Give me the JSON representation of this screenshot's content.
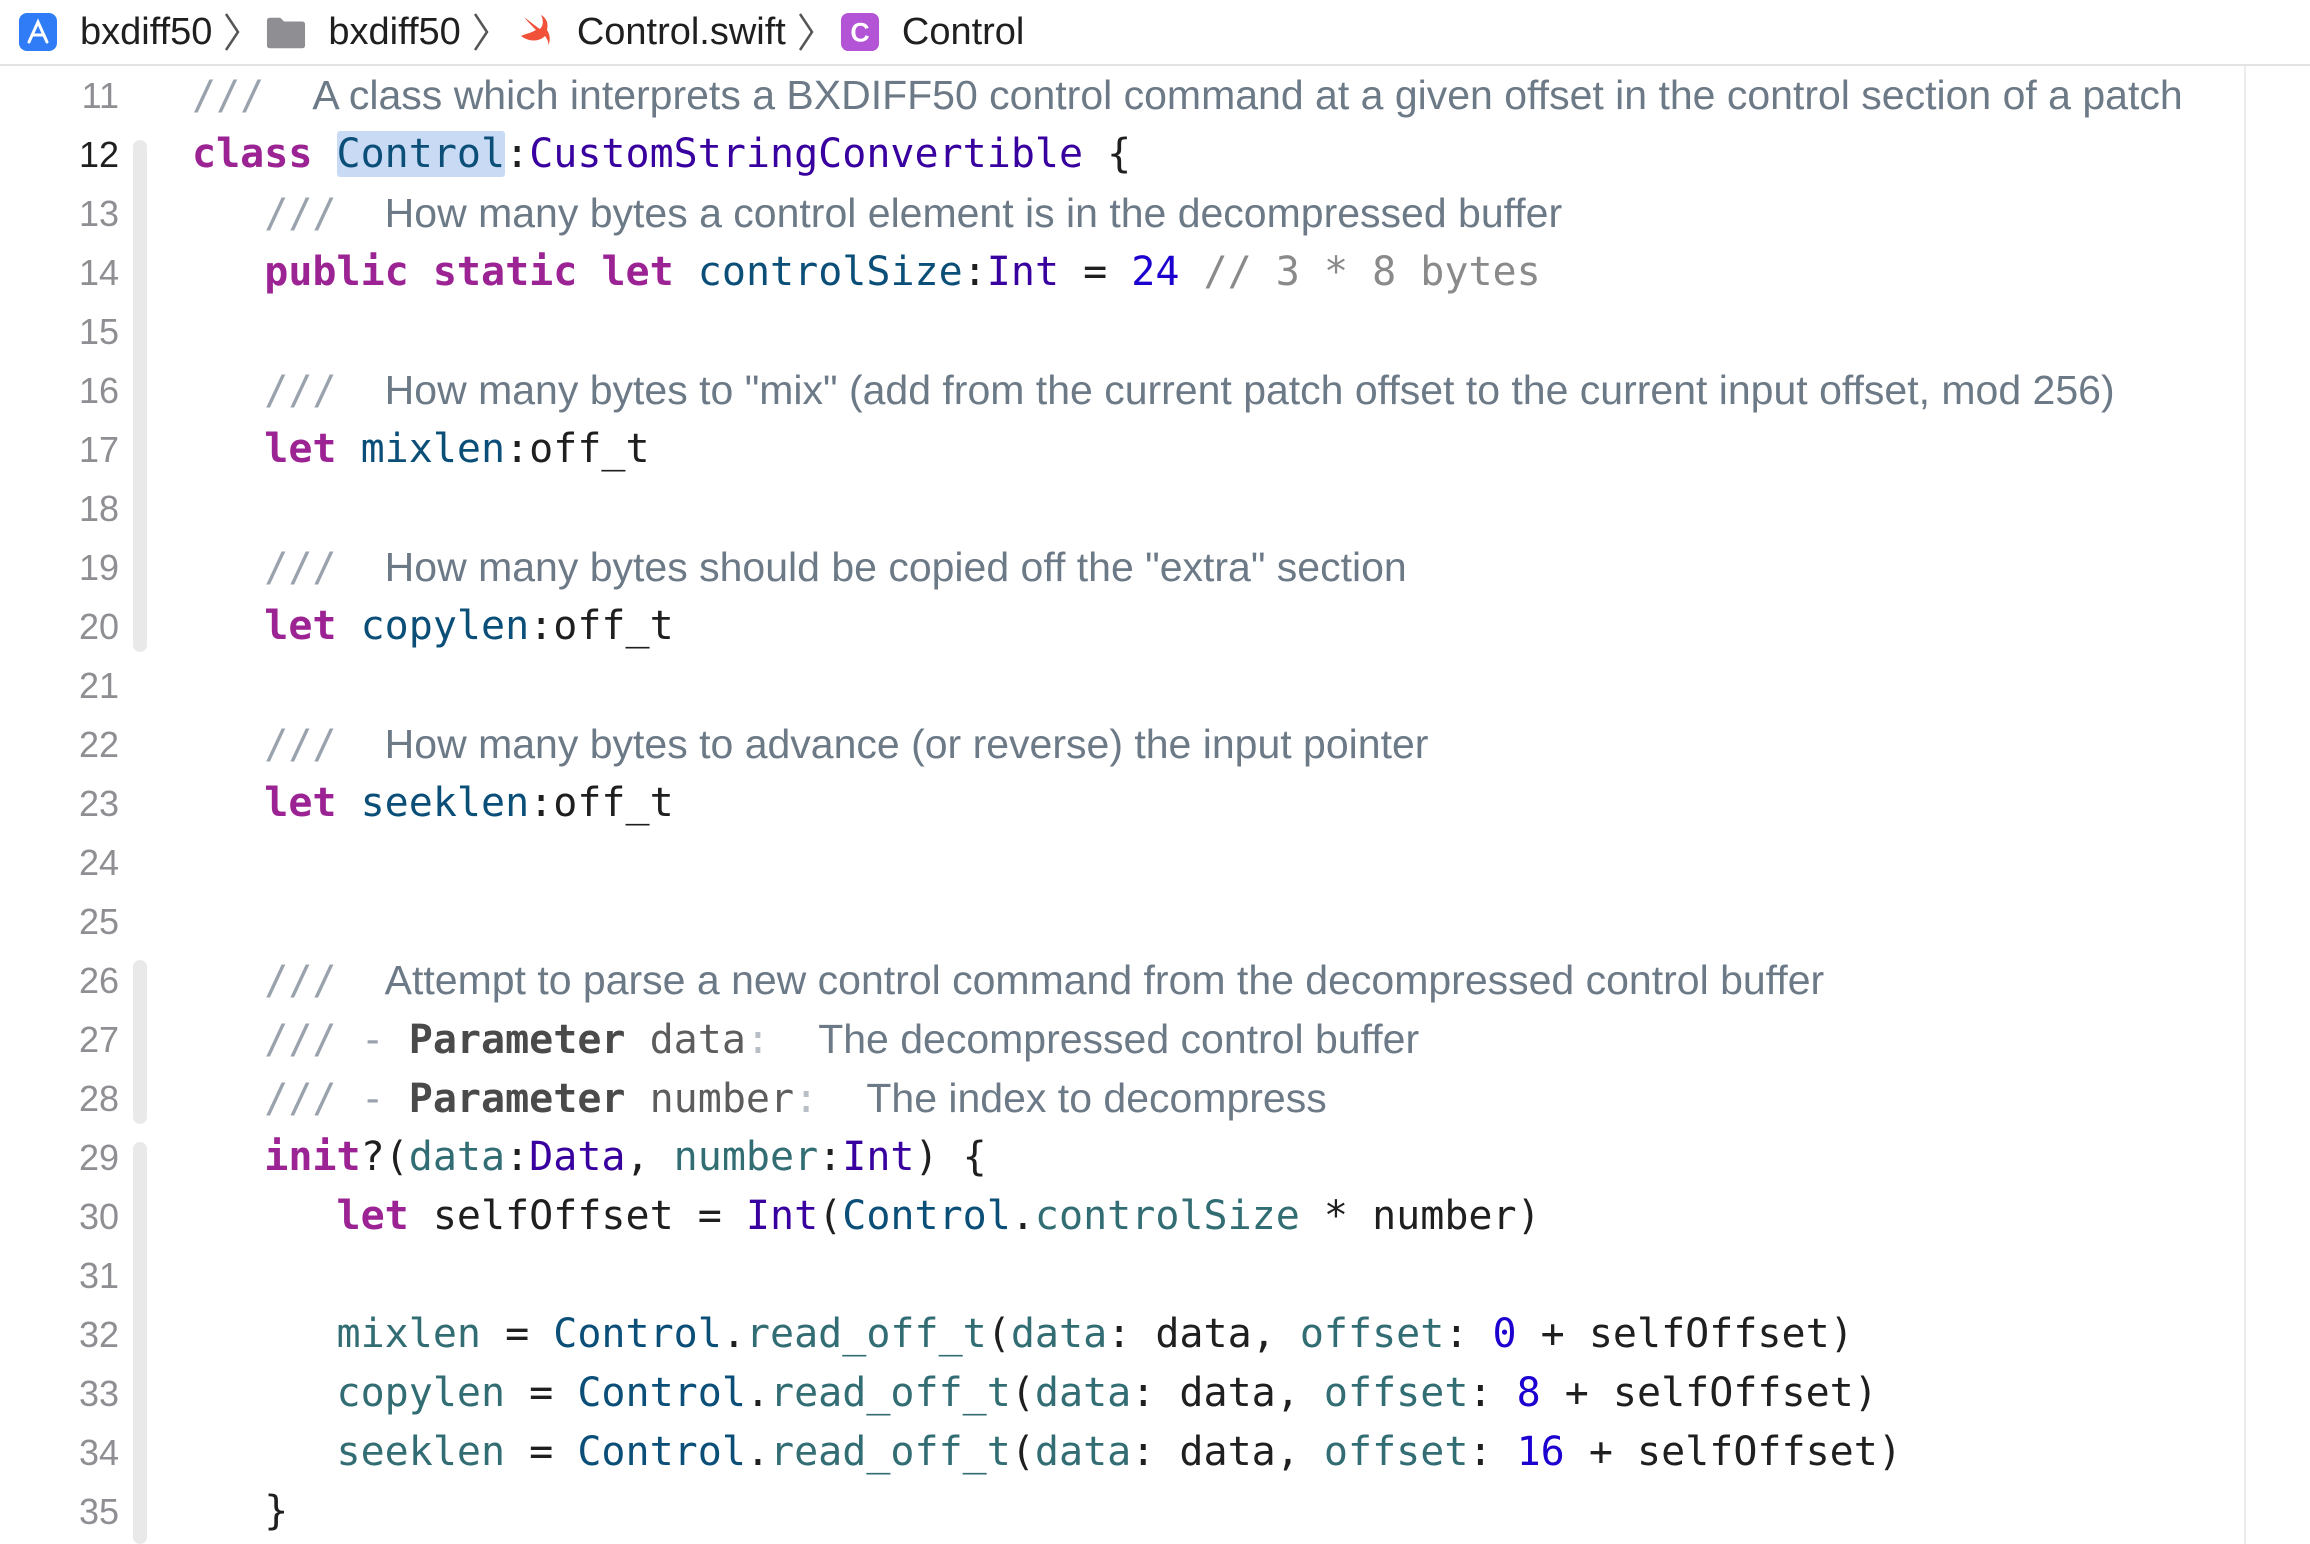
{
  "breadcrumb": {
    "items": [
      {
        "label": "bxdiff50",
        "icon": "xcode-project-icon"
      },
      {
        "label": "bxdiff50",
        "icon": "folder-icon"
      },
      {
        "label": "Control.swift",
        "icon": "swift-file-icon"
      },
      {
        "label": "Control",
        "icon": "class-symbol-icon",
        "badge": "C"
      }
    ]
  },
  "editor": {
    "current_line": "12",
    "selected_token": "Control",
    "colors": {
      "keyword": "#9b2393",
      "type": "#3900a0",
      "property": "#326d74",
      "number": "#1c00cf",
      "doc_comment": "#6c7986",
      "selection": "#c8daf4"
    },
    "lines": {
      "l11": {
        "n": "11",
        "t": [
          "///",
          "A class which interprets a BXDIFF50 control command at a given offset in the control section of a patch"
        ]
      },
      "l12": {
        "n": "12",
        "t": [
          "class",
          "Control",
          ":",
          "CustomStringConvertible",
          " {"
        ]
      },
      "l13": {
        "n": "13",
        "t": [
          "///",
          "How many bytes a control element is in the decompressed buffer"
        ]
      },
      "l14": {
        "n": "14",
        "t": [
          "public",
          "static",
          "let",
          "controlSize",
          ":",
          "Int",
          " = ",
          "24",
          " // 3 * 8 bytes"
        ]
      },
      "l15": {
        "n": "15"
      },
      "l16": {
        "n": "16",
        "t": [
          "///",
          "How many bytes to \"mix\" (add from the current patch offset to the current input offset, mod 256)"
        ]
      },
      "l17": {
        "n": "17",
        "t": [
          "let",
          "mixlen",
          ":off_t"
        ]
      },
      "l18": {
        "n": "18"
      },
      "l19": {
        "n": "19",
        "t": [
          "///",
          "How many bytes should be copied off the \"extra\" section"
        ]
      },
      "l20": {
        "n": "20",
        "t": [
          "let",
          "copylen",
          ":off_t"
        ]
      },
      "l21": {
        "n": "21"
      },
      "l22": {
        "n": "22",
        "t": [
          "///",
          "How many bytes to advance (or reverse) the input pointer"
        ]
      },
      "l23": {
        "n": "23",
        "t": [
          "let",
          "seeklen",
          ":off_t"
        ]
      },
      "l24": {
        "n": "24"
      },
      "l25": {
        "n": "25"
      },
      "l26": {
        "n": "26",
        "t": [
          "///",
          "Attempt to parse a new control command from the decompressed control buffer"
        ]
      },
      "l27": {
        "n": "27",
        "t": [
          "///",
          " - ",
          "Parameter",
          "data",
          ":",
          "The decompressed control buffer"
        ]
      },
      "l28": {
        "n": "28",
        "t": [
          "///",
          " - ",
          "Parameter",
          "number",
          ":",
          "The index to decompress"
        ]
      },
      "l29": {
        "n": "29",
        "t": [
          "init",
          "?(",
          "data",
          ":",
          "Data",
          ", ",
          "number",
          ":",
          "Int",
          ") {"
        ]
      },
      "l30": {
        "n": "30",
        "t": [
          "let",
          " selfOffset = ",
          "Int",
          "(",
          "Control",
          ".",
          "controlSize",
          " * number)"
        ]
      },
      "l31": {
        "n": "31"
      },
      "l32": {
        "n": "32",
        "t": [
          "mixlen",
          " = ",
          "Control",
          ".",
          "read_off_t",
          "(",
          "data",
          ": data, ",
          "offset",
          ": ",
          "0",
          " + selfOffset)"
        ]
      },
      "l33": {
        "n": "33",
        "t": [
          "copylen",
          " = ",
          "Control",
          ".",
          "read_off_t",
          "(",
          "data",
          ": data, ",
          "offset",
          ": ",
          "8",
          " + selfOffset)"
        ]
      },
      "l34": {
        "n": "34",
        "t": [
          "seeklen",
          " = ",
          "Control",
          ".",
          "read_off_t",
          "(",
          "data",
          ": data, ",
          "offset",
          ": ",
          "16",
          " + selfOffset)"
        ]
      },
      "l35": {
        "n": "35",
        "t": [
          "}"
        ]
      }
    }
  }
}
